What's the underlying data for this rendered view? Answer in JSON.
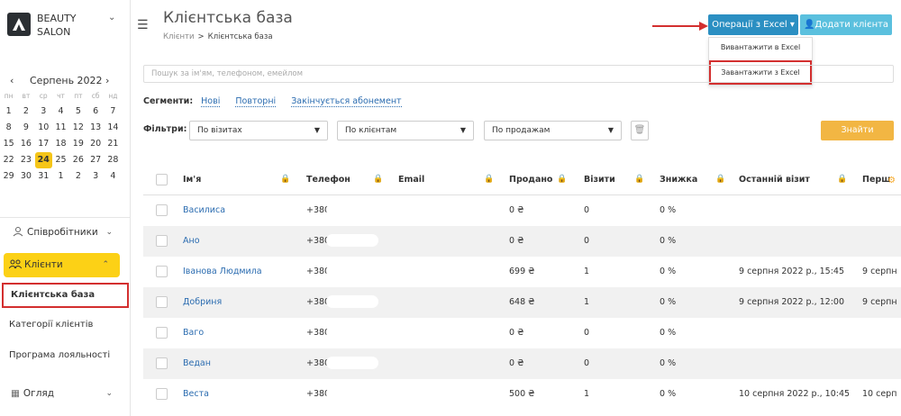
{
  "brand": {
    "line1": "BEAUTY",
    "line2": "SALON"
  },
  "calendar": {
    "month": "Серпень 2022",
    "prev": "‹",
    "next": "›",
    "weekdays": [
      "пн",
      "вт",
      "ср",
      "чт",
      "пт",
      "сб",
      "нд"
    ],
    "weeks": [
      [
        "1",
        "2",
        "3",
        "4",
        "5",
        "6",
        "7"
      ],
      [
        "8",
        "9",
        "10",
        "11",
        "12",
        "13",
        "14"
      ],
      [
        "15",
        "16",
        "17",
        "18",
        "19",
        "20",
        "21"
      ],
      [
        "22",
        "23",
        "24",
        "25",
        "26",
        "27",
        "28"
      ],
      [
        "29",
        "30",
        "31",
        "1",
        "2",
        "3",
        "4"
      ]
    ],
    "today": "24"
  },
  "nav": {
    "staff": "Співробітники",
    "clients": "Клієнти",
    "client_base": "Клієнтська база",
    "client_categories": "Категорії клієнтів",
    "loyalty": "Програма лояльності",
    "review": "Огляд"
  },
  "header": {
    "title": "Клієнтська база",
    "breadcrumb_parent": "Клієнти",
    "breadcrumb_sep": ">",
    "breadcrumb_current": "Клієнтська база",
    "excel_button": "Операції з Excel ▾",
    "add_button": "Додати клієнта"
  },
  "excel_menu": {
    "export": "Вивантажити в Excel",
    "import": "Завантажити з Excel"
  },
  "search": {
    "placeholder": "Пошук за ім'ям, телефоном, емейлом"
  },
  "segments": {
    "label": "Сегменти:",
    "items": [
      "Нові",
      "Повторні",
      "Закінчується абонемент"
    ]
  },
  "filters": {
    "label": "Фільтри:",
    "by_visits": "По візитах",
    "by_clients": "По клієнтам",
    "by_sales": "По продажам",
    "find": "Знайти"
  },
  "table": {
    "columns": [
      "Ім'я",
      "Телефон",
      "Email",
      "Продано",
      "Візити",
      "Знижка",
      "Останній візит",
      "Перш"
    ],
    "rows": [
      {
        "name": "Василиса",
        "phone": "+380",
        "sold": "0 ₴",
        "visits": "0",
        "discount": "0 %",
        "last": "",
        "first": ""
      },
      {
        "name": "Ано",
        "phone": "+380",
        "sold": "0 ₴",
        "visits": "0",
        "discount": "0 %",
        "last": "",
        "first": ""
      },
      {
        "name": "Іванова Людмила",
        "phone": "+380 ",
        "sold": "699 ₴",
        "visits": "1",
        "discount": "0 %",
        "last": "9 серпня 2022 р., 15:45",
        "first": "9 серпн"
      },
      {
        "name": "Добриня",
        "phone": "+380",
        "sold": "648 ₴",
        "visits": "1",
        "discount": "0 %",
        "last": "9 серпня 2022 р., 12:00",
        "first": "9 серпн"
      },
      {
        "name": "Ваго",
        "phone": "+380",
        "sold": "0 ₴",
        "visits": "0",
        "discount": "0 %",
        "last": "",
        "first": ""
      },
      {
        "name": "Ведан",
        "phone": "+380",
        "sold": "0 ₴",
        "visits": "0",
        "discount": "0 %",
        "last": "",
        "first": ""
      },
      {
        "name": "Веста",
        "phone": "+380",
        "sold": "500 ₴",
        "visits": "1",
        "discount": "0 %",
        "last": "10 серпня 2022 р., 10:45",
        "first": "10 серп"
      }
    ]
  },
  "colors": {
    "accent": "#2b8fc2",
    "highlight": "#fcd116",
    "find": "#f2b643",
    "annotation": "#d32f2f"
  }
}
